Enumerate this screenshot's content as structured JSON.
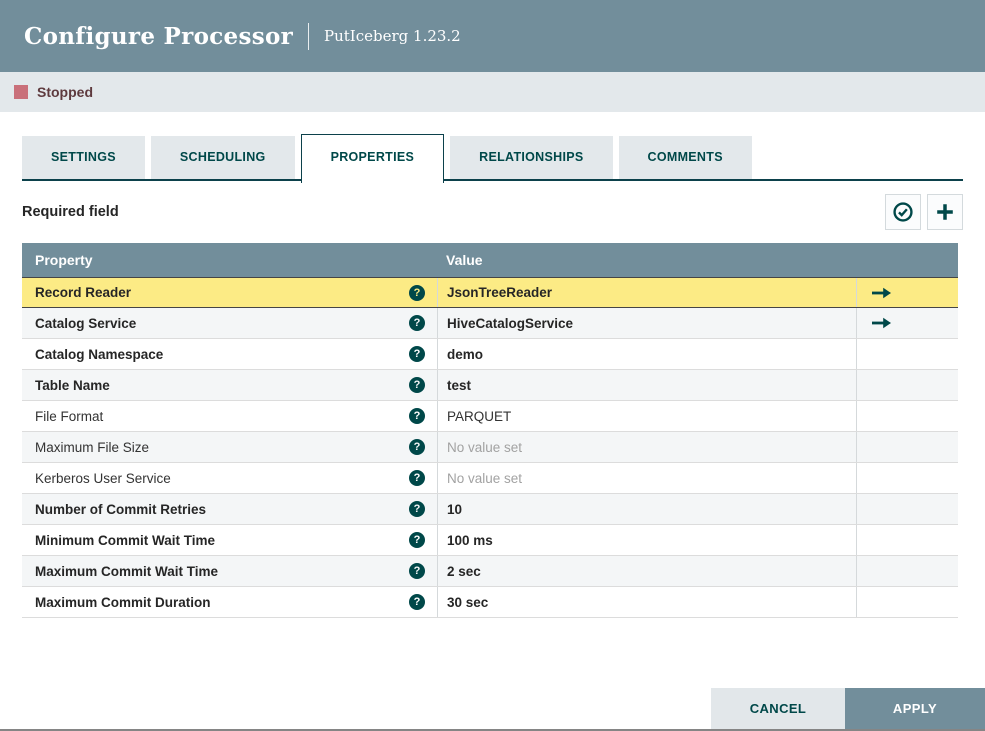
{
  "dialog": {
    "title": "Configure Processor",
    "subtitle": "PutIceberg 1.23.2"
  },
  "status": {
    "label": "Stopped",
    "color": "#C9707A"
  },
  "tabs": [
    {
      "label": "SETTINGS",
      "active": false
    },
    {
      "label": "SCHEDULING",
      "active": false
    },
    {
      "label": "PROPERTIES",
      "active": true
    },
    {
      "label": "RELATIONSHIPS",
      "active": false
    },
    {
      "label": "COMMENTS",
      "active": false
    }
  ],
  "toolbar": {
    "note": "Required field",
    "verify_button": "verify-properties-icon",
    "add_button": "add-property-icon"
  },
  "icons": {
    "help_glyph": "?"
  },
  "table": {
    "columns": [
      "Property",
      "Value"
    ],
    "unset_text": "No value set",
    "rows": [
      {
        "property": "Record Reader",
        "required": true,
        "value": "JsonTreeReader",
        "value_bold": true,
        "unset": false,
        "has_goto": true,
        "highlighted": true
      },
      {
        "property": "Catalog Service",
        "required": true,
        "value": "HiveCatalogService",
        "value_bold": true,
        "unset": false,
        "has_goto": true,
        "highlighted": false
      },
      {
        "property": "Catalog Namespace",
        "required": true,
        "value": "demo",
        "value_bold": true,
        "unset": false,
        "has_goto": false,
        "highlighted": false
      },
      {
        "property": "Table Name",
        "required": true,
        "value": "test",
        "value_bold": true,
        "unset": false,
        "has_goto": false,
        "highlighted": false
      },
      {
        "property": "File Format",
        "required": false,
        "value": "PARQUET",
        "value_bold": false,
        "unset": false,
        "has_goto": false,
        "highlighted": false
      },
      {
        "property": "Maximum File Size",
        "required": false,
        "value": "No value set",
        "value_bold": false,
        "unset": true,
        "has_goto": false,
        "highlighted": false
      },
      {
        "property": "Kerberos User Service",
        "required": false,
        "value": "No value set",
        "value_bold": false,
        "unset": true,
        "has_goto": false,
        "highlighted": false
      },
      {
        "property": "Number of Commit Retries",
        "required": true,
        "value": "10",
        "value_bold": true,
        "unset": false,
        "has_goto": false,
        "highlighted": false
      },
      {
        "property": "Minimum Commit Wait Time",
        "required": true,
        "value": "100 ms",
        "value_bold": true,
        "unset": false,
        "has_goto": false,
        "highlighted": false
      },
      {
        "property": "Maximum Commit Wait Time",
        "required": true,
        "value": "2 sec",
        "value_bold": true,
        "unset": false,
        "has_goto": false,
        "highlighted": false
      },
      {
        "property": "Maximum Commit Duration",
        "required": true,
        "value": "30 sec",
        "value_bold": true,
        "unset": false,
        "has_goto": false,
        "highlighted": false
      }
    ]
  },
  "footer": {
    "cancel_label": "CANCEL",
    "apply_label": "APPLY"
  },
  "colors": {
    "header_bg": "#728E9B",
    "accent_teal": "#004849",
    "status_bar_bg": "#E3E8EB",
    "highlight_row": "#FCEB85",
    "alt_row": "#F4F6F7"
  }
}
